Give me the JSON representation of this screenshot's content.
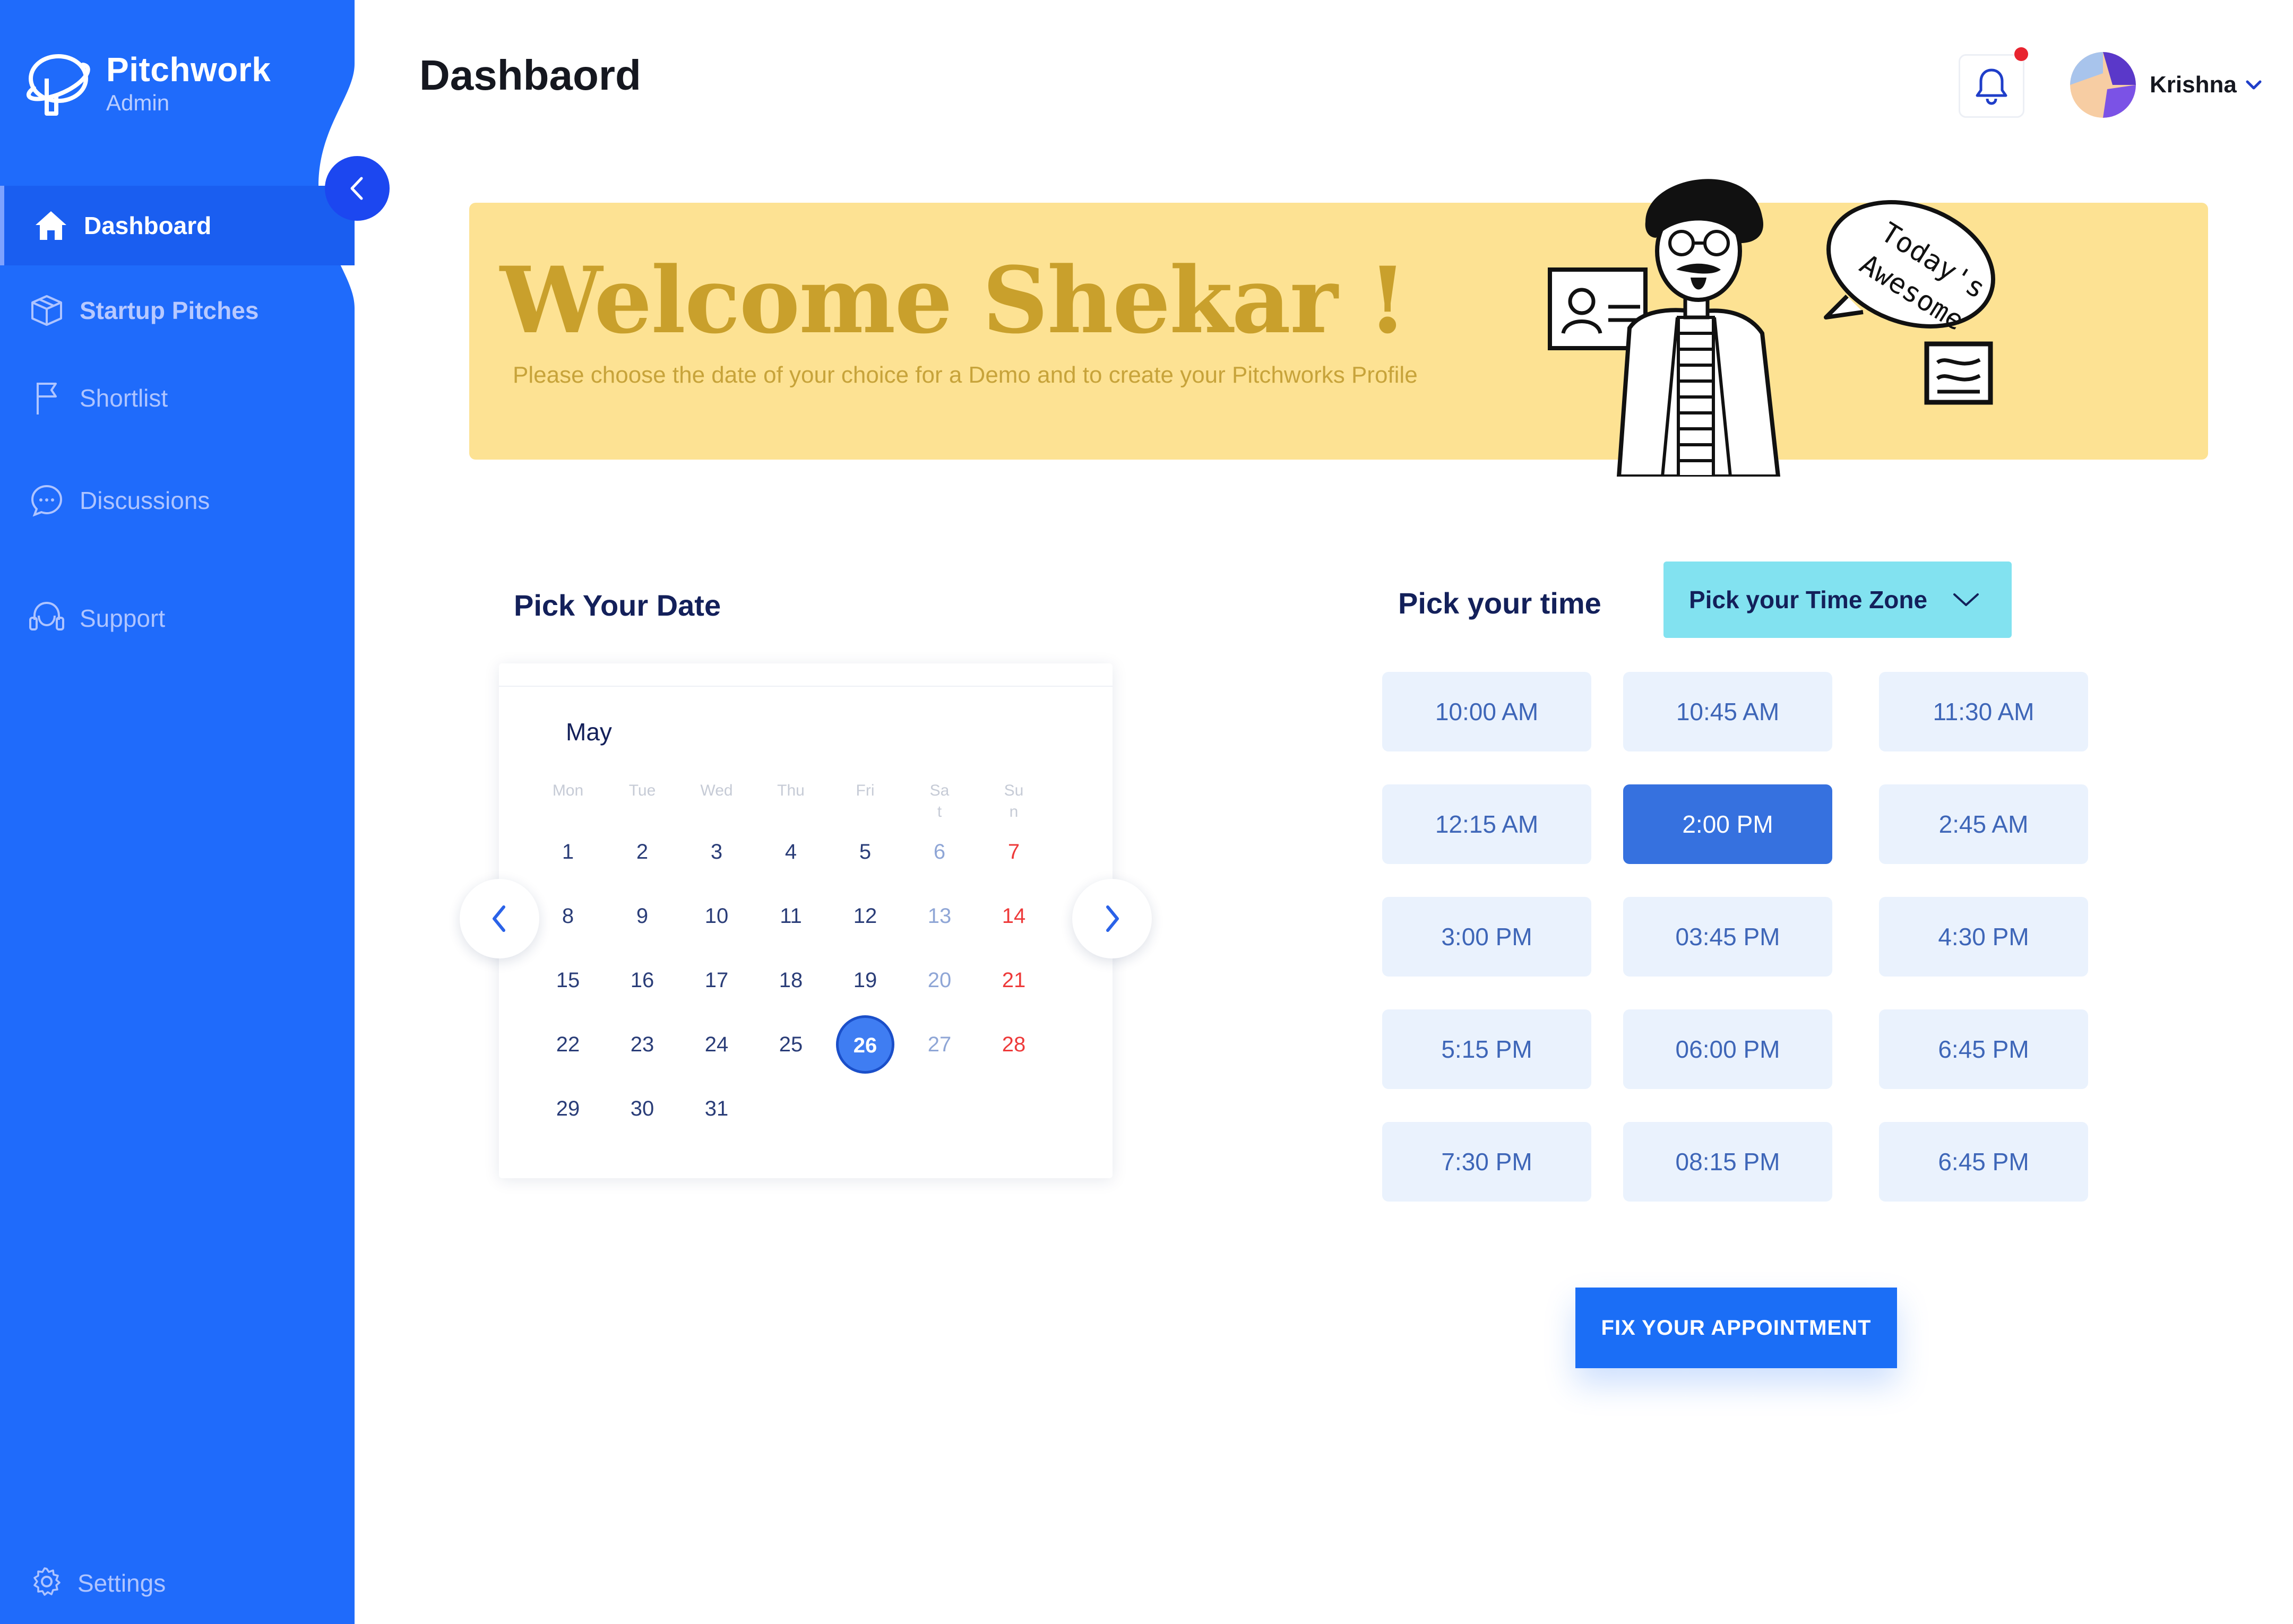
{
  "brand": {
    "name": "Pitchwork",
    "subtitle": "Admin"
  },
  "colors": {
    "sidebar": "#1f6bfb",
    "banner": "#fde293",
    "accent": "#1b6ef6",
    "slot": "#eaf2fd",
    "slot_selected": "#3671df",
    "timezone": "#82e2f0",
    "sunday": "#ee3a3a"
  },
  "sidebar": {
    "items": [
      {
        "label": "Dashboard",
        "icon": "home-icon",
        "active": true
      },
      {
        "label": "Startup Pitches",
        "icon": "box-icon"
      },
      {
        "label": "Shortlist",
        "icon": "flag-icon"
      },
      {
        "label": "Discussions",
        "icon": "chat-icon"
      },
      {
        "label": "Support",
        "icon": "headset-icon"
      }
    ],
    "settings": {
      "label": "Settings",
      "icon": "gear-icon"
    }
  },
  "header": {
    "title": "Dashbaord",
    "user_name": "Krishna",
    "has_notification": true
  },
  "banner": {
    "title": "Welcome Shekar  !",
    "subtitle": "Please choose the date of your choice for a Demo and to create your Pitchworks Profile",
    "bubble_text": "Today's Awesome"
  },
  "date_picker": {
    "title": "Pick Your Date",
    "month": "May",
    "weekdays": [
      [
        "Mon"
      ],
      [
        "Tue"
      ],
      [
        "Wed"
      ],
      [
        "Thu"
      ],
      [
        "Fri"
      ],
      [
        "Sa",
        "t"
      ],
      [
        "Su",
        "n"
      ]
    ],
    "weeks": [
      [
        "1",
        "2",
        "3",
        "4",
        "5",
        "6",
        "7"
      ],
      [
        "8",
        "9",
        "10",
        "11",
        "12",
        "13",
        "14"
      ],
      [
        "15",
        "16",
        "17",
        "18",
        "19",
        "20",
        "21"
      ],
      [
        "22",
        "23",
        "24",
        "25",
        "26",
        "27",
        "28"
      ],
      [
        "29",
        "30",
        "31",
        "",
        "",
        "",
        ""
      ]
    ],
    "selected_day": "26"
  },
  "time_picker": {
    "title": "Pick your time",
    "timezone_label": "Pick your Time Zone",
    "slots": [
      [
        "10:00 AM",
        "10:45 AM",
        "11:30 AM"
      ],
      [
        "12:15 AM",
        "2:00 PM",
        "2:45 AM"
      ],
      [
        "3:00 PM",
        "03:45 PM",
        "4:30 PM"
      ],
      [
        "5:15 PM",
        "06:00 PM",
        "6:45 PM"
      ],
      [
        "7:30 PM",
        "08:15 PM",
        "6:45 PM"
      ]
    ],
    "selected_slot": "2:00 PM"
  },
  "actions": {
    "submit_label": "FIX YOUR APPOINTMENT"
  }
}
